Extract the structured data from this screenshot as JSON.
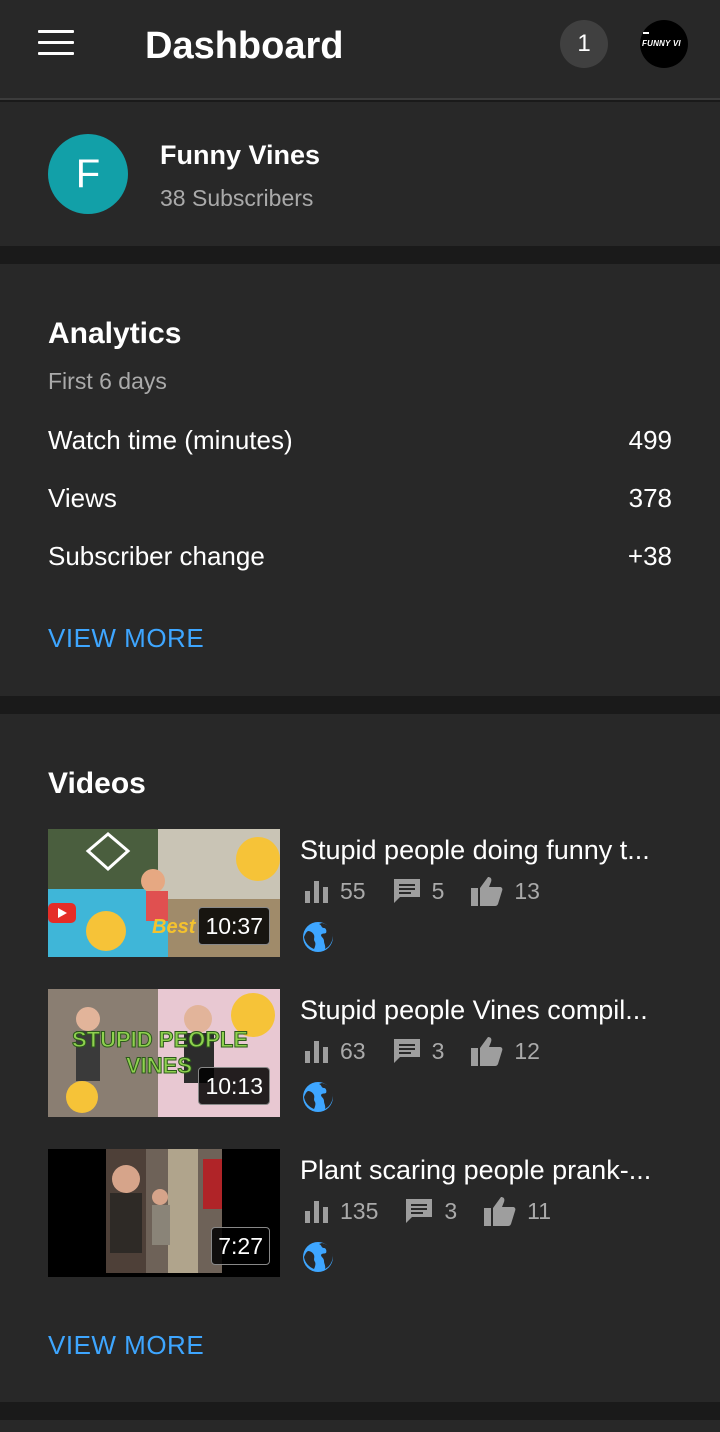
{
  "appbar": {
    "title": "Dashboard",
    "notification_count": "1",
    "avatar_text": "FUNNY VI"
  },
  "channel": {
    "initial": "F",
    "name": "Funny Vines",
    "subscribers": "38 Subscribers",
    "avatar_color": "#12a0a8"
  },
  "analytics": {
    "title": "Analytics",
    "period": "First 6 days",
    "metrics": [
      {
        "label": "Watch time (minutes)",
        "value": "499"
      },
      {
        "label": "Views",
        "value": "378"
      },
      {
        "label": "Subscriber change",
        "value": "+38"
      }
    ],
    "view_more": "VIEW MORE"
  },
  "videos": {
    "title": "Videos",
    "items": [
      {
        "title": "Stupid people doing funny t...",
        "duration": "10:37",
        "views": "55",
        "comments": "5",
        "likes": "13",
        "visibility_icon": "globe-icon"
      },
      {
        "title": "Stupid people Vines compil...",
        "duration": "10:13",
        "views": "63",
        "comments": "3",
        "likes": "12",
        "visibility_icon": "globe-icon"
      },
      {
        "title": "Plant scaring people prank-...",
        "duration": "7:27",
        "views": "135",
        "comments": "3",
        "likes": "11",
        "visibility_icon": "globe-icon"
      }
    ],
    "view_more": "VIEW MORE"
  },
  "colors": {
    "accent": "#3ea6ff",
    "surface": "#282828",
    "background": "#1a1a1a",
    "secondary_text": "#aaaaaa"
  }
}
